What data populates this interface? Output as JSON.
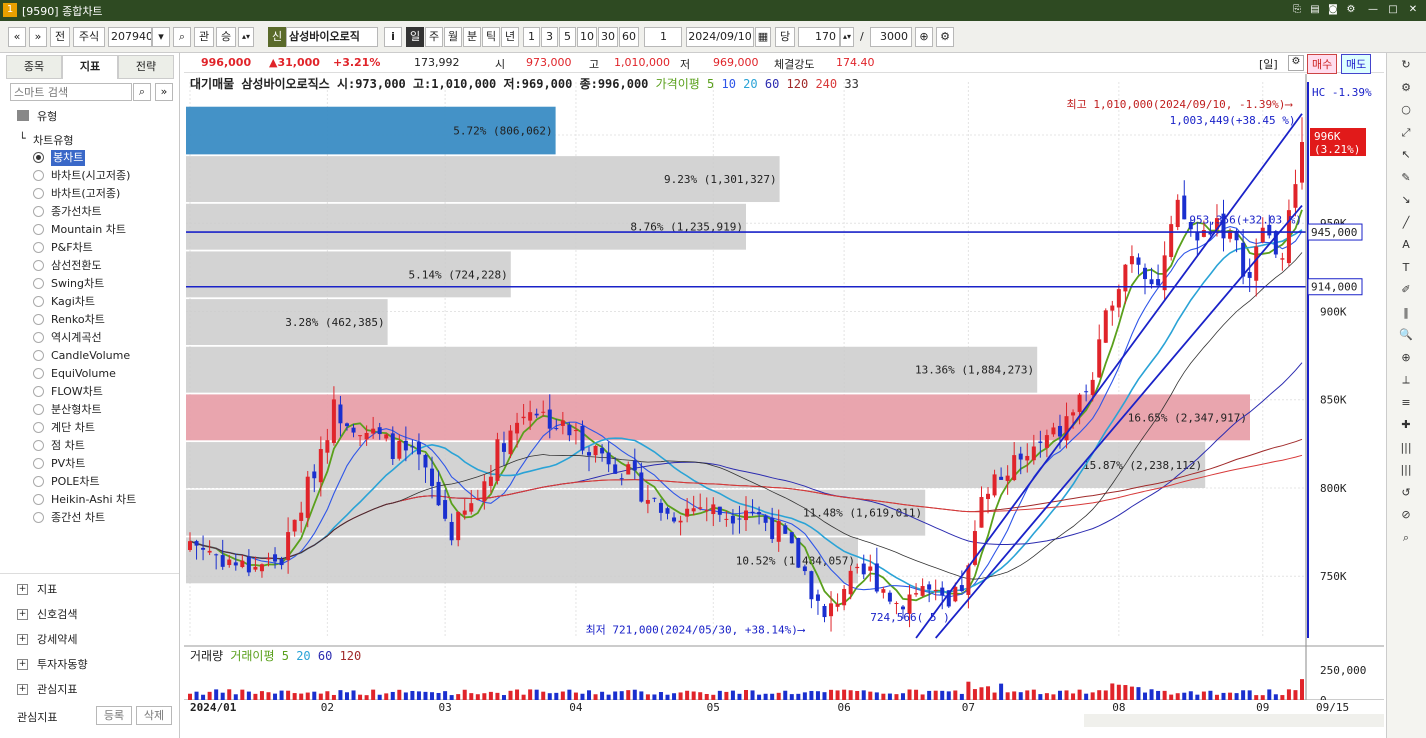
{
  "window": {
    "title": "[9590] 종합차트",
    "badge": "1 ?"
  },
  "toolbar": {
    "nav": [
      "«",
      "»"
    ],
    "jeon": "전",
    "market": "주식",
    "code": "207940",
    "caret": "▾",
    "gwan": "관",
    "sung": "승",
    "sin": "신",
    "name": "삼성바이오로직",
    "info": "i",
    "periods": [
      "일",
      "주",
      "월",
      "분",
      "틱",
      "년"
    ],
    "nums": [
      "1",
      "3",
      "5",
      "10",
      "30",
      "60"
    ],
    "unit": "1",
    "date": "2024/09/10",
    "dang": "당",
    "count": "170",
    "slash": "/",
    "total": "3000"
  },
  "leftpanel": {
    "tabs": [
      "종목",
      "지표",
      "전략"
    ],
    "search_placeholder": "스마트 검색",
    "tree_root": "유형",
    "tree_sub": "차트유형",
    "chart_types": [
      "봉차트",
      "바차트(시고저종)",
      "바차트(고저종)",
      "종가선차트",
      "Mountain 차트",
      "P&F차트",
      "삼선전환도",
      "Swing차트",
      "Kagi차트",
      "Renko차트",
      "역시계곡선",
      "CandleVolume",
      "EquiVolume",
      "FLOW차트",
      "분산형차트",
      "계단 차트",
      "점 차트",
      "PV차트",
      "POLE차트",
      "Heikin-Ashi 차트",
      "종간선 차트"
    ],
    "sections": [
      "지표",
      "신호검색",
      "강세약세",
      "투자자동향",
      "관심지표"
    ],
    "footer": {
      "label": "관심지표",
      "reg": "등록",
      "del": "삭제"
    }
  },
  "pricebar": {
    "price": "996,000",
    "change": "▲31,000",
    "pct": "+3.21%",
    "volume": "173,992",
    "open_l": "시",
    "open": "973,000",
    "high_l": "고",
    "high": "1,010,000",
    "low_l": "저",
    "low": "969,000",
    "str_l": "체결강도",
    "str": "174.40",
    "period": "[일]",
    "buy": "매수",
    "sell": "매도"
  },
  "colors": {
    "up": "#e0242a",
    "down": "#1a2fcf",
    "ma5": "#5aa01c",
    "ma10": "#2f56e8",
    "ma20": "#2aa3d6",
    "ma60": "#2b2bb0",
    "ma120": "#a02a2a",
    "ma240": "#d83a3a",
    "ma33": "#333333"
  },
  "chart_data": {
    "type": "candlestick",
    "legend": {
      "prefix": "대기매물",
      "name": "삼성바이오로직스",
      "ohlc": "시:973,000 고:1,010,000 저:969,000 종:996,000",
      "ma_label": "가격이평",
      "periods": [
        "5",
        "10",
        "20",
        "60",
        "120",
        "240",
        "33"
      ]
    },
    "y_axis": {
      "min": 715000,
      "max": 1030000,
      "ticks": [
        {
          "v": 1000000,
          "l": "1,000K"
        },
        {
          "v": 950000,
          "l": "950K"
        },
        {
          "v": 900000,
          "l": "900K"
        },
        {
          "v": 850000,
          "l": "850K"
        },
        {
          "v": 800000,
          "l": "800K"
        },
        {
          "v": 750000,
          "l": "750K"
        }
      ],
      "hc_label": "HC -1.39%",
      "current_tag": "996K",
      "current_pct": "(3.21%)",
      "line_tags": [
        {
          "v": 945000,
          "l": "945,000"
        },
        {
          "v": 914000,
          "l": "914,000"
        }
      ]
    },
    "x_axis": {
      "labels": [
        {
          "i": 0,
          "l": "2024/01"
        },
        {
          "i": 21,
          "l": "02"
        },
        {
          "i": 39,
          "l": "03"
        },
        {
          "i": 59,
          "l": "04"
        },
        {
          "i": 80,
          "l": "05"
        },
        {
          "i": 100,
          "l": "06"
        },
        {
          "i": 119,
          "l": "07"
        },
        {
          "i": 142,
          "l": "08"
        },
        {
          "i": 164,
          "l": "09"
        }
      ],
      "end_label": "09/15",
      "n": 171
    },
    "volume_profile": [
      {
        "lo": 989000,
        "hi": 1016000,
        "pct": "5.72%",
        "vol": "806,062",
        "w": 0.33,
        "hl": "blue"
      },
      {
        "lo": 962000,
        "hi": 988000,
        "pct": "9.23%",
        "vol": "1,301,327",
        "w": 0.53
      },
      {
        "lo": 935000,
        "hi": 961000,
        "pct": "8.76%",
        "vol": "1,235,919",
        "w": 0.5
      },
      {
        "lo": 908000,
        "hi": 934000,
        "pct": "5.14%",
        "vol": "724,228",
        "w": 0.29
      },
      {
        "lo": 881000,
        "hi": 907000,
        "pct": "3.28%",
        "vol": "462,385",
        "w": 0.18
      },
      {
        "lo": 854000,
        "hi": 880000,
        "pct": "13.36%",
        "vol": "1,884,273",
        "w": 0.76
      },
      {
        "lo": 827000,
        "hi": 853000,
        "pct": "16.65%",
        "vol": "2,347,917",
        "w": 0.95,
        "hl": "red"
      },
      {
        "lo": 800000,
        "hi": 826000,
        "pct": "15.87%",
        "vol": "2,238,112",
        "w": 0.91
      },
      {
        "lo": 773000,
        "hi": 799000,
        "pct": "11.48%",
        "vol": "1,619,011",
        "w": 0.66
      },
      {
        "lo": 746000,
        "hi": 772000,
        "pct": "10.52%",
        "vol": "1,484,057",
        "w": 0.6
      }
    ],
    "annotations": {
      "high": "최고 1,010,000(2024/09/10, -1.39%)⟶",
      "low": "최저 721,000(2024/05/30, +38.14%)⟶",
      "high_point": "1,003,449(+38.45 %)",
      "mid_point": "953,356(+32.03 %)",
      "low_point": "724,566( 5 )"
    },
    "volume": {
      "legend": "거래량",
      "ma_label": "거래이평",
      "periods": [
        "5",
        "20",
        "60",
        "120"
      ],
      "ticks": [
        {
          "v": 250000,
          "l": "250,000"
        },
        {
          "v": 0,
          "l": "0"
        }
      ],
      "max": 300000
    }
  }
}
